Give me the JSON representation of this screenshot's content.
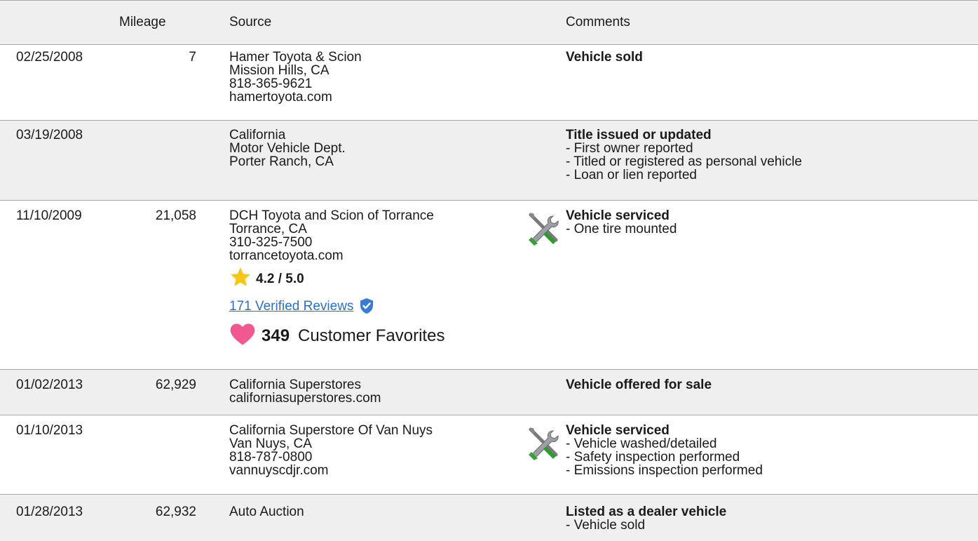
{
  "header": {
    "mileage": "Mileage",
    "source": "Source",
    "comments": "Comments"
  },
  "rows": [
    {
      "date": "02/25/2008",
      "mileage": "7",
      "source": [
        "Hamer Toyota & Scion",
        "Mission Hills, CA",
        "818-365-9621",
        "hamertoyota.com"
      ],
      "comment_title": "Vehicle sold",
      "comment_items": []
    },
    {
      "date": "03/19/2008",
      "mileage": "",
      "source": [
        "California",
        "Motor Vehicle Dept.",
        "Porter Ranch, CA"
      ],
      "comment_title": "Title issued or updated",
      "comment_items": [
        "- First owner reported",
        "- Titled or registered as personal vehicle",
        "- Loan or lien reported"
      ]
    },
    {
      "date": "11/10/2009",
      "mileage": "21,058",
      "source": [
        "DCH Toyota and Scion of Torrance",
        "Torrance, CA",
        "310-325-7500",
        "torrancetoyota.com"
      ],
      "rating": "4.2 / 5.0",
      "reviews_link": "171 Verified Reviews",
      "favorites_count": "349",
      "favorites_label": "Customer Favorites",
      "icon": "service-wrench-icon",
      "comment_title": "Vehicle serviced",
      "comment_items": [
        "- One tire mounted"
      ]
    },
    {
      "date": "01/02/2013",
      "mileage": "62,929",
      "source": [
        "California Superstores",
        "californiasuperstores.com"
      ],
      "comment_title": "Vehicle offered for sale",
      "comment_items": []
    },
    {
      "date": "01/10/2013",
      "mileage": "",
      "source": [
        "California Superstore Of Van Nuys",
        "Van Nuys, CA",
        "818-787-0800",
        "vannuyscdjr.com"
      ],
      "icon": "service-wrench-icon",
      "comment_title": "Vehicle serviced",
      "comment_items": [
        "- Vehicle washed/detailed",
        "- Safety inspection performed",
        "- Emissions inspection performed"
      ]
    },
    {
      "date": "01/28/2013",
      "mileage": "62,932",
      "source": [
        "Auto Auction"
      ],
      "comment_title": "Listed as a dealer vehicle",
      "comment_items": [
        "- Vehicle sold"
      ]
    }
  ],
  "colors": {
    "header_bg": "#efefef",
    "row_alt_bg": "#efefef",
    "border": "#a9a9a9",
    "link": "#2e6fc0",
    "star": "#f7c515",
    "heart": "#f0588f",
    "verified_badge": "#3a7bd5"
  }
}
